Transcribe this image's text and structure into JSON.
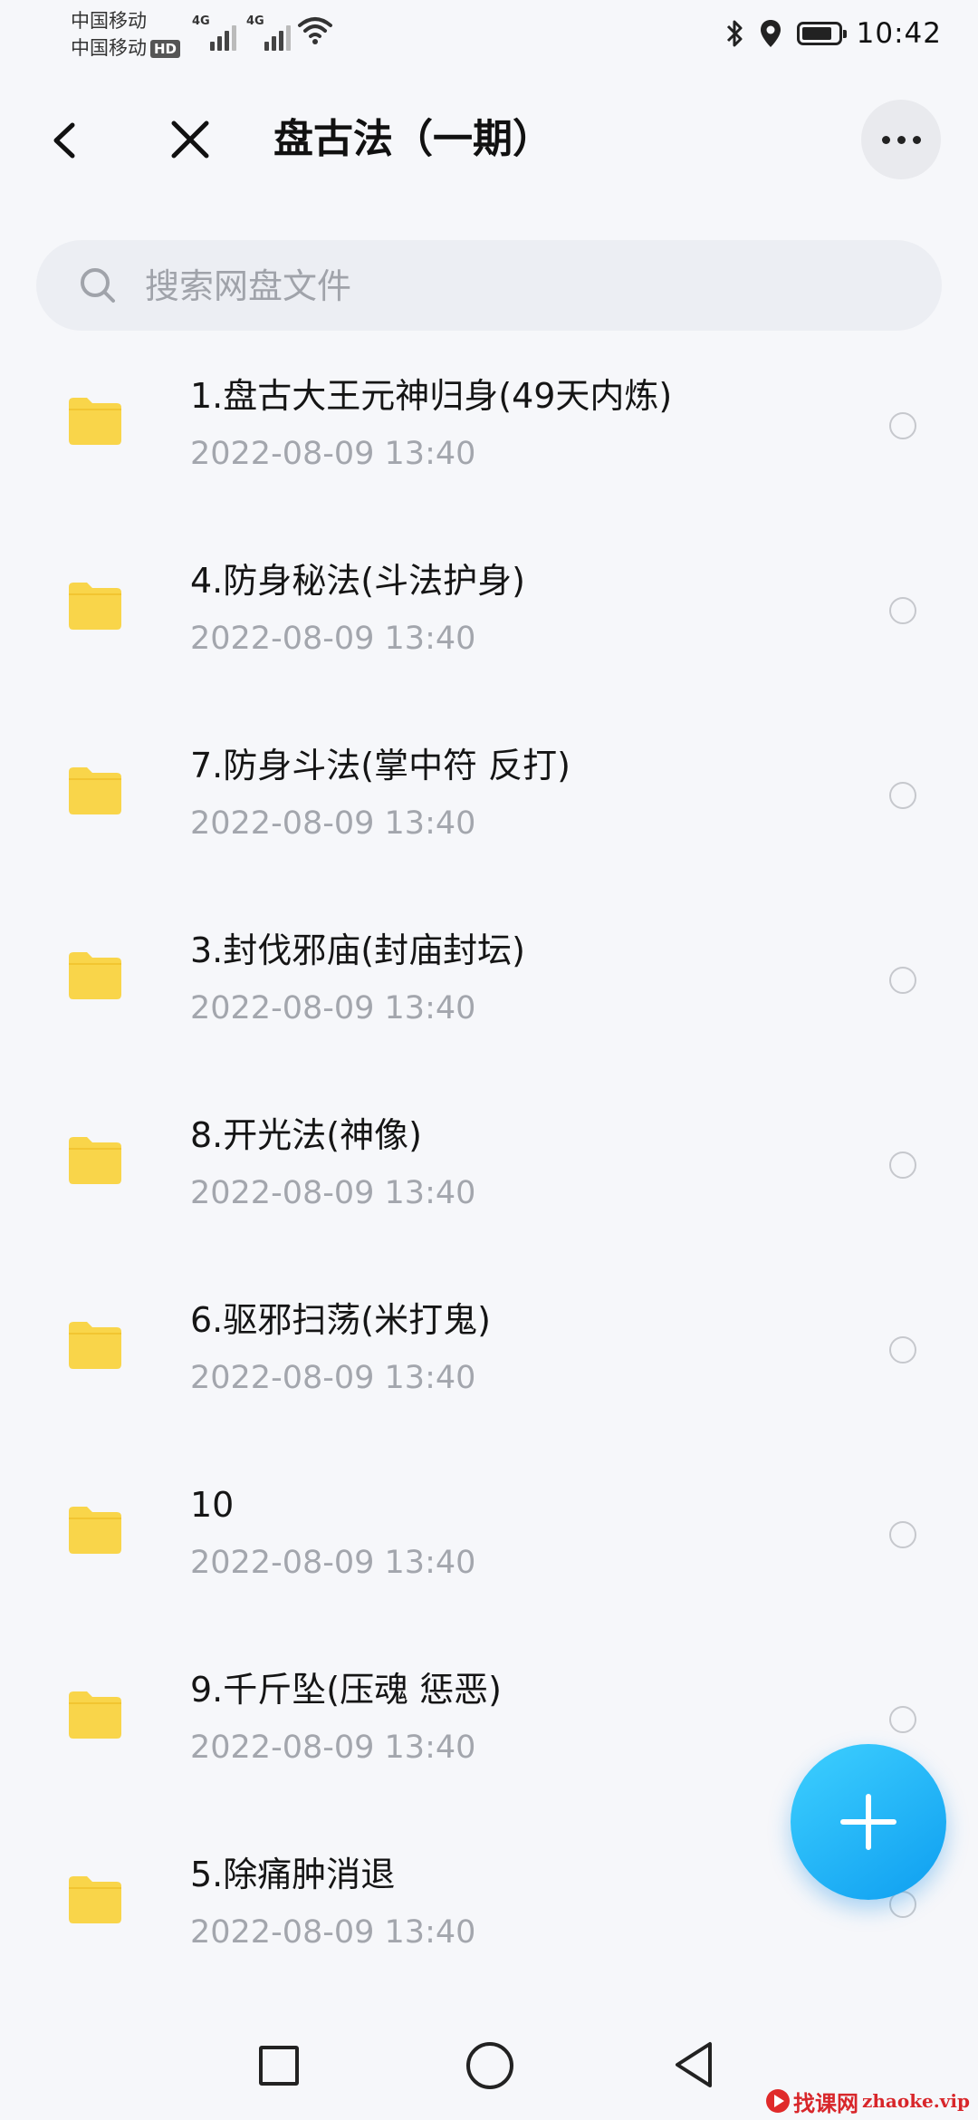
{
  "status_bar": {
    "carrier_1": "中国移动",
    "carrier_2": "中国移动",
    "hd_badge": "HD",
    "signal_1": "4G",
    "signal_2": "4G",
    "time": "10:42",
    "battery_level": 0.85
  },
  "header": {
    "title": "盘古法（一期）"
  },
  "search": {
    "placeholder": "搜索网盘文件"
  },
  "files": [
    {
      "name": "1.盘古大王元神归身(49天内炼)",
      "date": "2022-08-09  13:40"
    },
    {
      "name": "4.防身秘法(斗法护身)",
      "date": "2022-08-09  13:40"
    },
    {
      "name": "7.防身斗法(掌中符 反打)",
      "date": "2022-08-09  13:40"
    },
    {
      "name": "3.封伐邪庙(封庙封坛)",
      "date": "2022-08-09  13:40"
    },
    {
      "name": "8.开光法(神像)",
      "date": "2022-08-09  13:40"
    },
    {
      "name": "6.驱邪扫荡(米打鬼)",
      "date": "2022-08-09  13:40"
    },
    {
      "name": "10",
      "date": "2022-08-09  13:40"
    },
    {
      "name": "9.千斤坠(压魂 惩恶)",
      "date": "2022-08-09  13:40"
    },
    {
      "name": "5.除痛肿消退",
      "date": "2022-08-09  13:40"
    }
  ],
  "watermark": {
    "cn": "找课网",
    "en": "zhaoke.vip"
  },
  "colors": {
    "folder": "#f9d54a",
    "fab": "#1aacf5",
    "background": "#f6f7fa"
  }
}
